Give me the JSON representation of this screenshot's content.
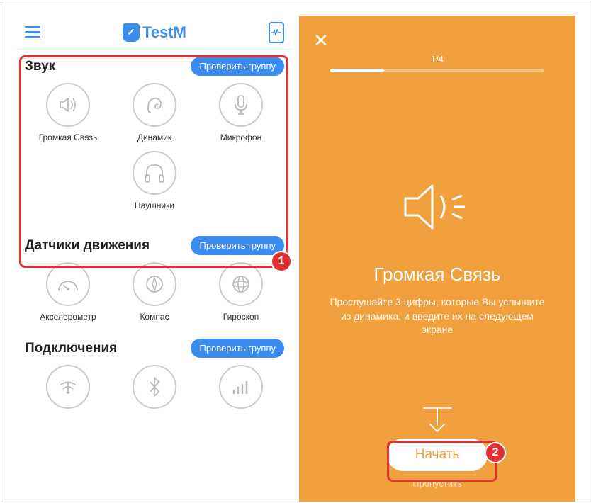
{
  "app_name": "TestM",
  "left": {
    "sections": [
      {
        "title": "Звук",
        "check_label": "Проверить группу",
        "items": [
          {
            "label": "Громкая Связь"
          },
          {
            "label": "Динамик"
          },
          {
            "label": "Микрофон"
          },
          {
            "label": "Наушники"
          }
        ]
      },
      {
        "title": "Датчики движения",
        "check_label": "Проверить группу",
        "items": [
          {
            "label": "Акселерометр"
          },
          {
            "label": "Компас"
          },
          {
            "label": "Гироскоп"
          }
        ]
      },
      {
        "title": "Подключения",
        "check_label": "Проверить группу",
        "items": [
          {
            "label": ""
          },
          {
            "label": ""
          },
          {
            "label": ""
          }
        ]
      }
    ]
  },
  "right": {
    "progress_label": "1/4",
    "title": "Громкая Связь",
    "description": "Прослушайте 3 цифры, которые Вы услышите из динамика, и введите их на следующем экране",
    "start_label": "Начать",
    "skip_label": "Пропустить"
  },
  "annotations": {
    "badge1": "1",
    "badge2": "2"
  }
}
